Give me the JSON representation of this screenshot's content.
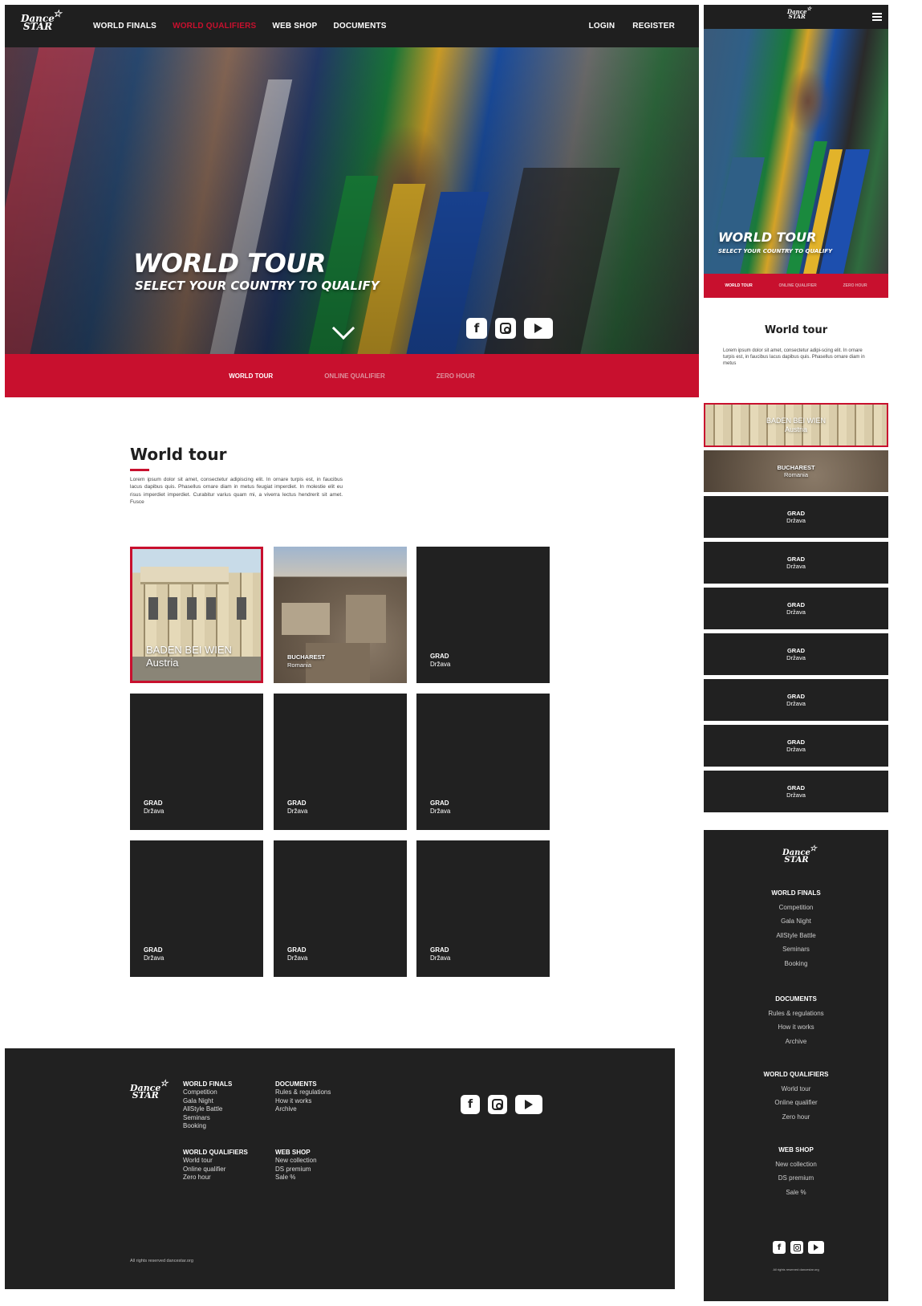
{
  "brand": {
    "logo_line1": "Dance",
    "logo_line2": "STAR"
  },
  "nav": {
    "items": [
      "WORLD FINALS",
      "WORLD QUALIFIERS",
      "WEB SHOP",
      "DOCUMENTS"
    ],
    "active_index": 1,
    "login": "LOGIN",
    "register": "REGISTER"
  },
  "hero": {
    "title": "WORLD TOUR",
    "subtitle": "SELECT YOUR COUNTRY TO QUALIFY",
    "social": [
      "facebook-icon",
      "instagram-icon",
      "youtube-icon"
    ]
  },
  "tabs": [
    "WORLD TOUR",
    "ONLINE QUALIFIER",
    "ZERO HOUR"
  ],
  "section": {
    "title": "World tour",
    "lorem": "Lorem ipsum dolor sit amet, consectetur adipiscing elit. In ornare turpis est, in faucibus lacus dapibus quis. Phasellus ornare diam in metus feugiat imperdiet. In molestie elit eu risus imperdiet imperdiet. Curabitur varius quam mi, a viverra lectus hendrerit sit amet. Fusce",
    "lorem_mobile": "Lorem ipsum dolor sit amet, consectetur adipi-scing elit. In ornare turpis est, in faucibus lacus dapibus quis. Phasellus ornare diam in metus"
  },
  "cities": [
    {
      "city": "BADEN BEI WIEN",
      "country": "Austria"
    },
    {
      "city": "BUCHAREST",
      "country": "Romania"
    },
    {
      "city": "GRAD",
      "country": "Država"
    },
    {
      "city": "GRAD",
      "country": "Država"
    },
    {
      "city": "GRAD",
      "country": "Država"
    },
    {
      "city": "GRAD",
      "country": "Država"
    },
    {
      "city": "GRAD",
      "country": "Država"
    },
    {
      "city": "GRAD",
      "country": "Država"
    },
    {
      "city": "GRAD",
      "country": "Država"
    }
  ],
  "footer": {
    "world_finals": {
      "title": "WORLD FINALS",
      "items": [
        "Competition",
        "Gala Night",
        "AllStyle Battle",
        "Seminars",
        "Booking"
      ]
    },
    "documents": {
      "title": "DOCUMENTS",
      "items": [
        "Rules & regulations",
        "How it works",
        "Archive"
      ]
    },
    "world_qualifiers": {
      "title": "WORLD QUALIFIERS",
      "items": [
        "World tour",
        "Online qualifier",
        "Zero hour"
      ]
    },
    "web_shop": {
      "title": "WEB SHOP",
      "items": [
        "New collection",
        "DS premium",
        "Sale %"
      ]
    },
    "rights": "All rights reserved dancestar.org",
    "rights_mobile": "All rights reserved dancestar.org"
  },
  "colors": {
    "accent": "#c8102e",
    "dark": "#212121",
    "text": "#1e1e1e"
  }
}
